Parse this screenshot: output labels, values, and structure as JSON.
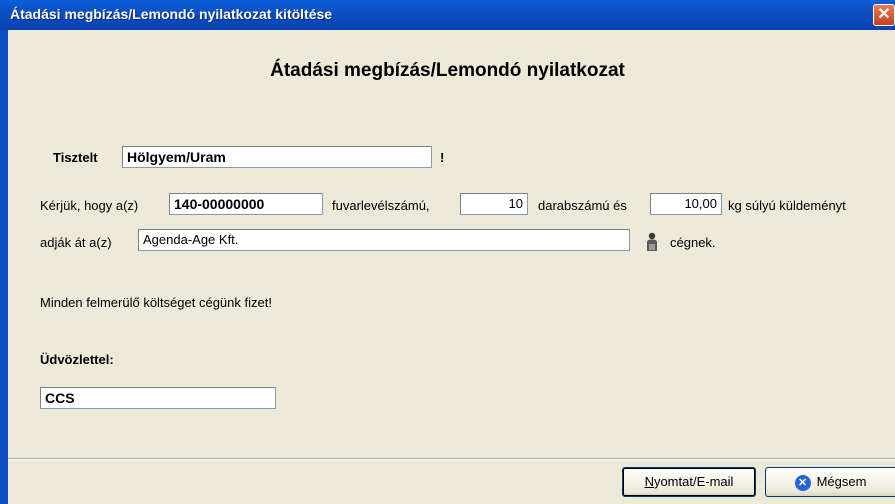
{
  "window": {
    "title": "Átadási megbízás/Lemondó nyilatkozat kitöltése",
    "close_glyph": "✕"
  },
  "form": {
    "heading": "Átadási megbízás/Lemondó nyilatkozat",
    "salutation_label": "Tisztelt",
    "salutation_value": "Hölgyem/Uram",
    "exclamation": "!",
    "request_prefix": "Kérjük, hogy a(z)",
    "waybill_number": "140-00000000",
    "waybill_suffix": "fuvarlevélszámú,",
    "piece_count": "10",
    "piece_suffix": "darabszámú és",
    "weight": "10,00",
    "weight_suffix": "kg súlyú küldeményt",
    "handover_prefix": "adják át a(z)",
    "company": "Agenda-Age Kft.",
    "company_suffix": "cégnek.",
    "costs_note": "Minden felmerülő költséget cégünk fizet!",
    "regards_label": "Üdvözlettel:",
    "signature": "CCS"
  },
  "buttons": {
    "print_hotkey": "N",
    "print_rest": "yomtat/E-mail",
    "cancel_label": "Mégsem",
    "cancel_icon": "✕"
  },
  "icons": {
    "person": "person-icon",
    "cancel": "close-circle-icon"
  }
}
